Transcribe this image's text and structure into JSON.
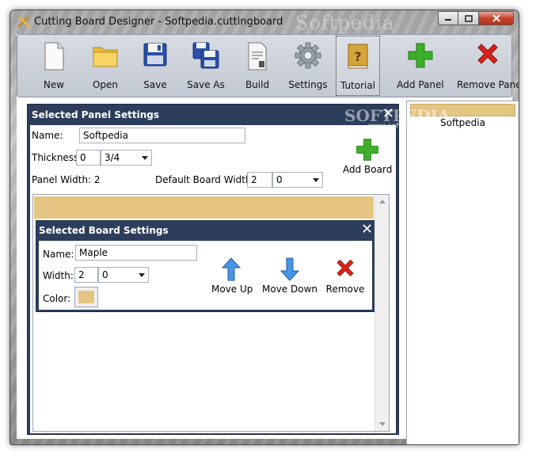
{
  "window": {
    "title": "Cutting Board Designer - Softpedia.cuttingboard",
    "watermark": "Softpedia"
  },
  "toolbar": {
    "items": [
      {
        "label": "New",
        "icon": "new-document-icon"
      },
      {
        "label": "Open",
        "icon": "folder-icon"
      },
      {
        "label": "Save",
        "icon": "floppy-disk-icon"
      },
      {
        "label": "Save As",
        "icon": "floppy-disks-icon"
      },
      {
        "label": "Build",
        "icon": "build-sheet-icon"
      },
      {
        "label": "Settings",
        "icon": "gear-icon"
      },
      {
        "label": "Tutorial",
        "icon": "help-book-icon",
        "active": true
      },
      {
        "label": "Add Panel",
        "icon": "green-plus-icon"
      },
      {
        "label": "Remove Panel",
        "icon": "red-x-icon"
      }
    ]
  },
  "panel_list": {
    "items": [
      {
        "name": "Softpedia",
        "color": "#e4c682"
      }
    ]
  },
  "panel_settings": {
    "header": "Selected Panel Settings",
    "watermark": "SOFTPEDIA",
    "watermark_url": "www.softpedia.com",
    "name_label": "Name:",
    "name_value": "Softpedia",
    "thickness_label": "Thickness:",
    "thickness_whole": "0",
    "thickness_fraction": "3/4",
    "panel_width_label": "Panel Width: 2",
    "default_board_width_label": "Default Board Width:",
    "default_board_width_whole": "2",
    "default_board_width_fraction": "0",
    "add_board_label": "Add Board"
  },
  "board_settings": {
    "header": "Selected Board Settings",
    "name_label": "Name:",
    "name_value": "Maple",
    "width_label": "Width:",
    "width_whole": "2",
    "width_fraction": "0",
    "color_label": "Color:",
    "color": "#e4c682",
    "move_up_label": "Move Up",
    "move_down_label": "Move Down",
    "remove_label": "Remove"
  }
}
